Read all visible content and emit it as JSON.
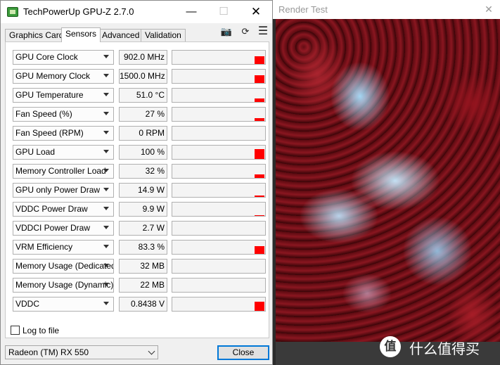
{
  "gpuz": {
    "title": "TechPowerUp GPU-Z 2.7.0",
    "tabs": [
      {
        "label": "Graphics Card"
      },
      {
        "label": "Sensors"
      },
      {
        "label": "Advanced"
      },
      {
        "label": "Validation"
      }
    ],
    "active_tab": "Sensors",
    "sensors": [
      {
        "label": "GPU Core Clock",
        "value": "902.0 MHz",
        "level": 0.6
      },
      {
        "label": "GPU Memory Clock",
        "value": "1500.0 MHz",
        "level": 0.6
      },
      {
        "label": "GPU Temperature",
        "value": "51.0 °C",
        "level": 0.25
      },
      {
        "label": "Fan Speed (%)",
        "value": "27 %",
        "level": 0.2
      },
      {
        "label": "Fan Speed (RPM)",
        "value": "0 RPM",
        "level": 0
      },
      {
        "label": "GPU Load",
        "value": "100 %",
        "level": 0.75
      },
      {
        "label": "Memory Controller Load",
        "value": "32 %",
        "level": 0.25
      },
      {
        "label": "GPU only Power Draw",
        "value": "14.9 W",
        "level": 0.1
      },
      {
        "label": "VDDC Power Draw",
        "value": "9.9 W",
        "level": 0.06
      },
      {
        "label": "VDDCI Power Draw",
        "value": "2.7 W",
        "level": 0
      },
      {
        "label": "VRM Efficiency",
        "value": "83.3 %",
        "level": 0.6
      },
      {
        "label": "Memory Usage (Dedicated)",
        "value": "32 MB",
        "level": 0
      },
      {
        "label": "Memory Usage (Dynamic)",
        "value": "22 MB",
        "level": 0
      },
      {
        "label": "VDDC",
        "value": "0.8438 V",
        "level": 0.7
      }
    ],
    "log_to_file_label": "Log to file",
    "log_to_file_checked": false,
    "gpu_select_value": "Radeon (TM) RX 550",
    "close_label": "Close",
    "bar_color": "#ff0000"
  },
  "render": {
    "title": "Render Test"
  },
  "watermark": {
    "logo_char": "值",
    "text": "什么值得买"
  }
}
